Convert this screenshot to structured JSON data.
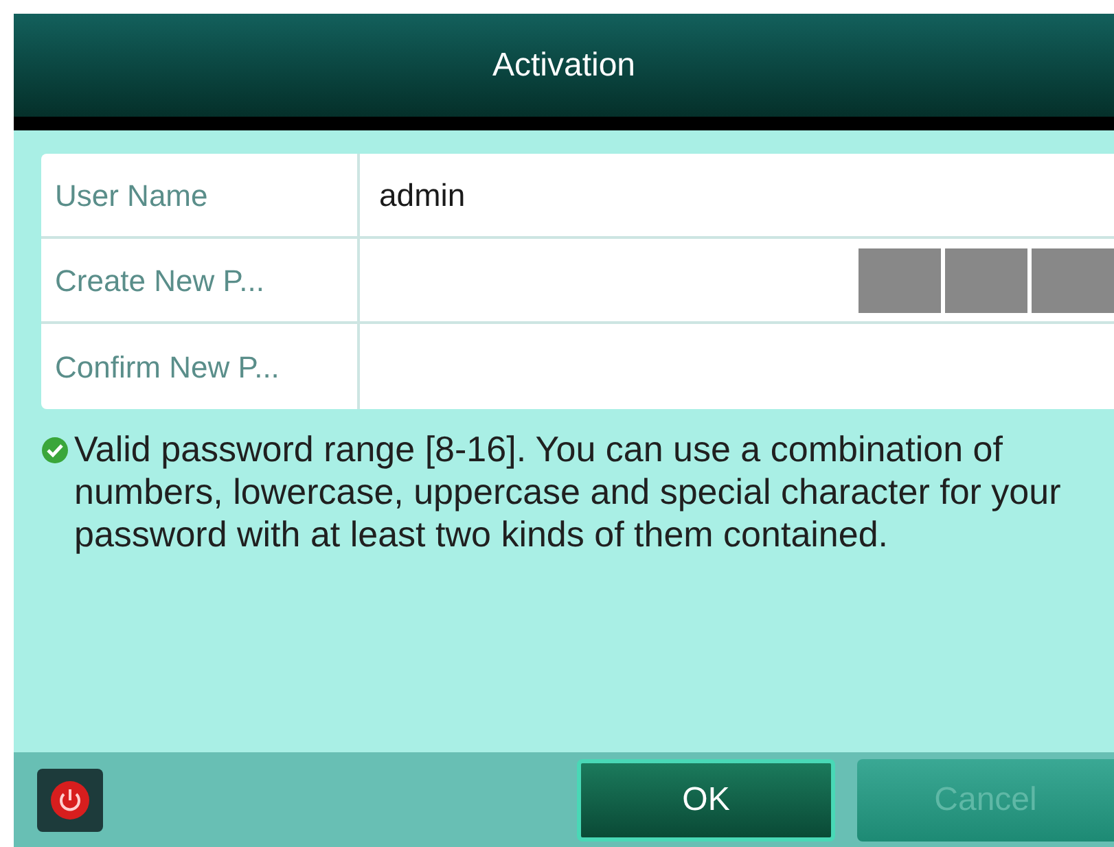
{
  "window": {
    "title": "Activation"
  },
  "fields": [
    {
      "label": "User Name",
      "value": "admin",
      "kind": "text"
    },
    {
      "label": "Create New P...",
      "kind": "password-meter"
    },
    {
      "label": "Confirm New P...",
      "kind": "password"
    }
  ],
  "hint": {
    "valid": true,
    "text": "Valid password range [8-16]. You can use a combination of numbers, lowercase, uppercase and special character for your password with at least two kinds of them contained."
  },
  "buttons": [
    {
      "label": "OK",
      "disabled": false
    },
    {
      "label": "Cancel",
      "disabled": true
    }
  ]
}
